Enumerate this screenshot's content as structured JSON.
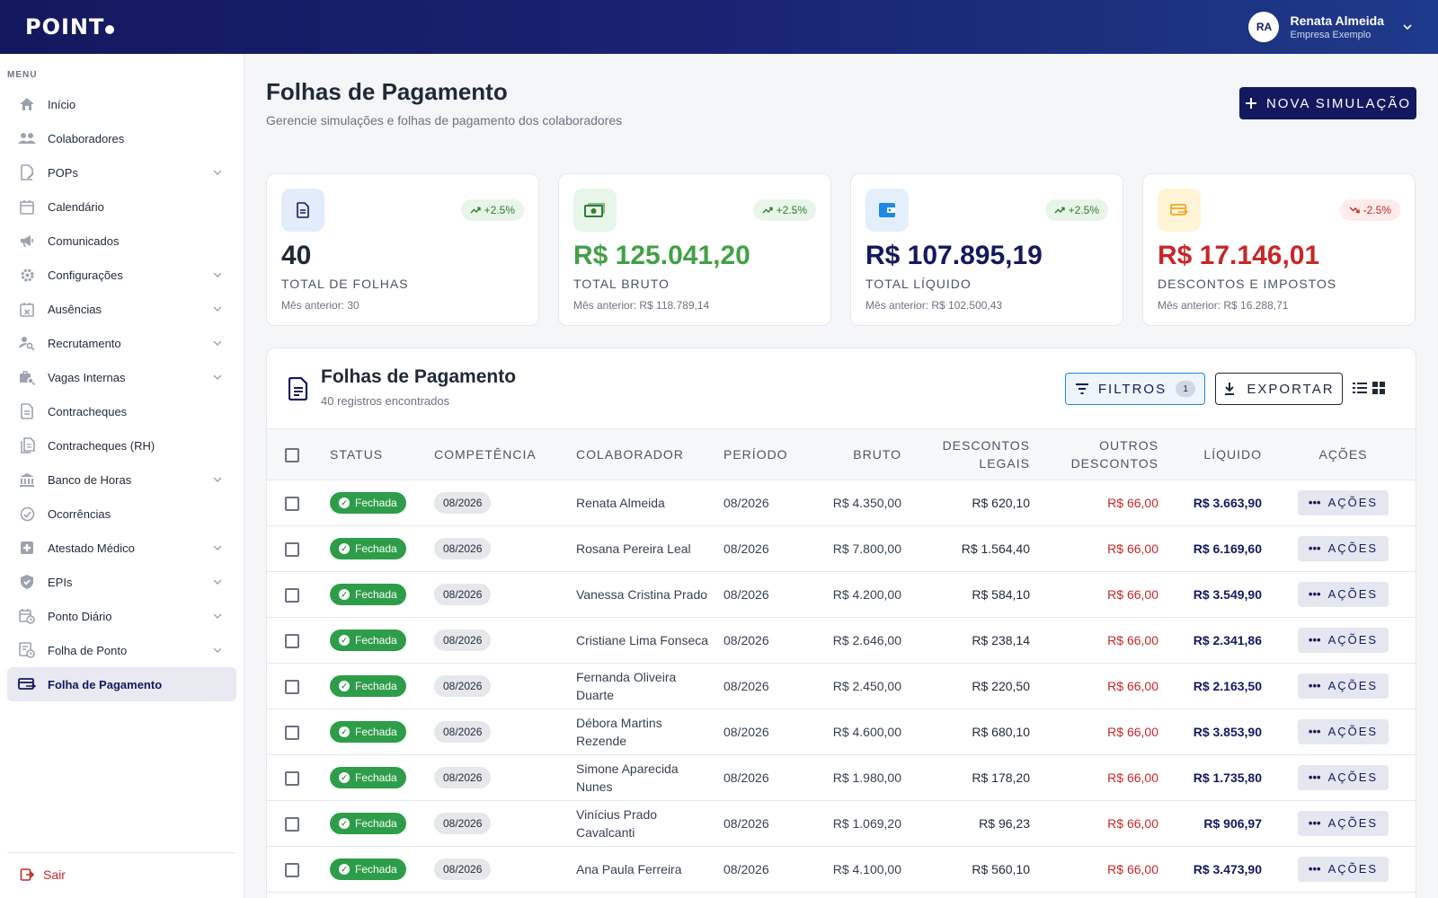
{
  "app": {
    "logo": "POINT"
  },
  "user": {
    "initials": "RA",
    "name": "Renata Almeida",
    "company": "Empresa Exemplo"
  },
  "sidebar": {
    "menu_title": "MENU",
    "items": [
      {
        "label": "Início",
        "icon": "home-icon",
        "chevron": false
      },
      {
        "label": "Colaboradores",
        "icon": "people-icon",
        "chevron": false
      },
      {
        "label": "POPs",
        "icon": "document-edit-icon",
        "chevron": true
      },
      {
        "label": "Calendário",
        "icon": "calendar-icon",
        "chevron": false
      },
      {
        "label": "Comunicados",
        "icon": "megaphone-icon",
        "chevron": false
      },
      {
        "label": "Configurações",
        "icon": "gear-icon",
        "chevron": true
      },
      {
        "label": "Ausências",
        "icon": "calendar-x-icon",
        "chevron": true
      },
      {
        "label": "Recrutamento",
        "icon": "person-search-icon",
        "chevron": true
      },
      {
        "label": "Vagas Internas",
        "icon": "job-search-icon",
        "chevron": true
      },
      {
        "label": "Contracheques",
        "icon": "document-icon",
        "chevron": false
      },
      {
        "label": "Contracheques (RH)",
        "icon": "documents-icon",
        "chevron": false
      },
      {
        "label": "Banco de Horas",
        "icon": "bank-icon",
        "chevron": true
      },
      {
        "label": "Ocorrências",
        "icon": "check-circle-icon",
        "chevron": false
      },
      {
        "label": "Atestado Médico",
        "icon": "medical-icon",
        "chevron": true
      },
      {
        "label": "EPIs",
        "icon": "shield-icon",
        "chevron": true
      },
      {
        "label": "Ponto Diário",
        "icon": "calendar-clock-icon",
        "chevron": true
      },
      {
        "label": "Folha de Ponto",
        "icon": "sheet-clock-icon",
        "chevron": true
      },
      {
        "label": "Folha de Pagamento",
        "icon": "payment-icon",
        "chevron": false,
        "active": true
      }
    ],
    "logout": "Sair"
  },
  "page": {
    "title": "Folhas de Pagamento",
    "subtitle": "Gerencie simulações e folhas de pagamento dos colaboradores",
    "new_button": "NOVA SIMULAÇÃO"
  },
  "cards": [
    {
      "icon": "document-icon",
      "icon_bg": "#e3ecfb",
      "icon_color": "#14185e",
      "badge": "+2.5%",
      "trend": "up",
      "value": "40",
      "value_color": "#1f2937",
      "label": "TOTAL DE FOLHAS",
      "prev": "Mês anterior: 30"
    },
    {
      "icon": "money-icon",
      "icon_bg": "#e8f5e9",
      "icon_color": "#2e7d32",
      "badge": "+2.5%",
      "trend": "up",
      "value": "R$ 125.041,20",
      "value_color": "#43a047",
      "label": "TOTAL BRUTO",
      "prev": "Mês anterior: R$ 118.789,14"
    },
    {
      "icon": "wallet-icon",
      "icon_bg": "#e3f0fb",
      "icon_color": "#1e88e5",
      "badge": "+2.5%",
      "trend": "up",
      "value": "R$ 107.895,19",
      "value_color": "#14185e",
      "label": "TOTAL LÍQUIDO",
      "prev": "Mês anterior: R$ 102.500,43"
    },
    {
      "icon": "payment-icon",
      "icon_bg": "#fff4d6",
      "icon_color": "#f5a623",
      "badge": "-2.5%",
      "trend": "down",
      "value": "R$ 17.146,01",
      "value_color": "#c62828",
      "label": "DESCONTOS E IMPOSTOS",
      "prev": "Mês anterior: R$ 16.288,71"
    }
  ],
  "panel": {
    "title": "Folhas de Pagamento",
    "subtitle": "40 registros encontrados",
    "filter_label": "FILTROS",
    "filter_count": "1",
    "export_label": "EXPORTAR"
  },
  "table": {
    "headers": {
      "status": "STATUS",
      "competencia": "COMPETÊNCIA",
      "colaborador": "COLABORADOR",
      "periodo": "PERÍODO",
      "bruto": "BRUTO",
      "descontos_legais_1": "DESCONTOS",
      "descontos_legais_2": "LEGAIS",
      "outros_1": "OUTROS",
      "outros_2": "DESCONTOS",
      "liquido": "LÍQUIDO",
      "acoes": "AÇÕES"
    },
    "rows": [
      {
        "status": "Fechada",
        "competencia": "08/2026",
        "colaborador": "Renata Almeida",
        "periodo": "08/2026",
        "bruto": "R$ 4.350,00",
        "descontos_legais": "R$ 620,10",
        "outros": "R$ 66,00",
        "liquido": "R$ 3.663,90",
        "acoes": "AÇÕES"
      },
      {
        "status": "Fechada",
        "competencia": "08/2026",
        "colaborador": "Rosana Pereira Leal",
        "periodo": "08/2026",
        "bruto": "R$ 7.800,00",
        "descontos_legais": "R$ 1.564,40",
        "outros": "R$ 66,00",
        "liquido": "R$ 6.169,60",
        "acoes": "AÇÕES"
      },
      {
        "status": "Fechada",
        "competencia": "08/2026",
        "colaborador": "Vanessa Cristina Prado",
        "periodo": "08/2026",
        "bruto": "R$ 4.200,00",
        "descontos_legais": "R$ 584,10",
        "outros": "R$ 66,00",
        "liquido": "R$ 3.549,90",
        "acoes": "AÇÕES"
      },
      {
        "status": "Fechada",
        "competencia": "08/2026",
        "colaborador": "Cristiane Lima Fonseca",
        "periodo": "08/2026",
        "bruto": "R$ 2.646,00",
        "descontos_legais": "R$ 238,14",
        "outros": "R$ 66,00",
        "liquido": "R$ 2.341,86",
        "acoes": "AÇÕES"
      },
      {
        "status": "Fechada",
        "competencia": "08/2026",
        "colaborador": "Fernanda Oliveira Duarte",
        "periodo": "08/2026",
        "bruto": "R$ 2.450,00",
        "descontos_legais": "R$ 220,50",
        "outros": "R$ 66,00",
        "liquido": "R$ 2.163,50",
        "acoes": "AÇÕES"
      },
      {
        "status": "Fechada",
        "competencia": "08/2026",
        "colaborador": "Débora Martins Rezende",
        "periodo": "08/2026",
        "bruto": "R$ 4.600,00",
        "descontos_legais": "R$ 680,10",
        "outros": "R$ 66,00",
        "liquido": "R$ 3.853,90",
        "acoes": "AÇÕES"
      },
      {
        "status": "Fechada",
        "competencia": "08/2026",
        "colaborador": "Simone Aparecida Nunes",
        "periodo": "08/2026",
        "bruto": "R$ 1.980,00",
        "descontos_legais": "R$ 178,20",
        "outros": "R$ 66,00",
        "liquido": "R$ 1.735,80",
        "acoes": "AÇÕES"
      },
      {
        "status": "Fechada",
        "competencia": "08/2026",
        "colaborador": "Vinícius Prado Cavalcanti",
        "periodo": "08/2026",
        "bruto": "R$ 1.069,20",
        "descontos_legais": "R$ 96,23",
        "outros": "R$ 66,00",
        "liquido": "R$ 906,97",
        "acoes": "AÇÕES"
      },
      {
        "status": "Fechada",
        "competencia": "08/2026",
        "colaborador": "Ana Paula Ferreira",
        "periodo": "08/2026",
        "bruto": "R$ 4.100,00",
        "descontos_legais": "R$ 560,10",
        "outros": "R$ 66,00",
        "liquido": "R$ 3.473,90",
        "acoes": "AÇÕES"
      }
    ]
  }
}
